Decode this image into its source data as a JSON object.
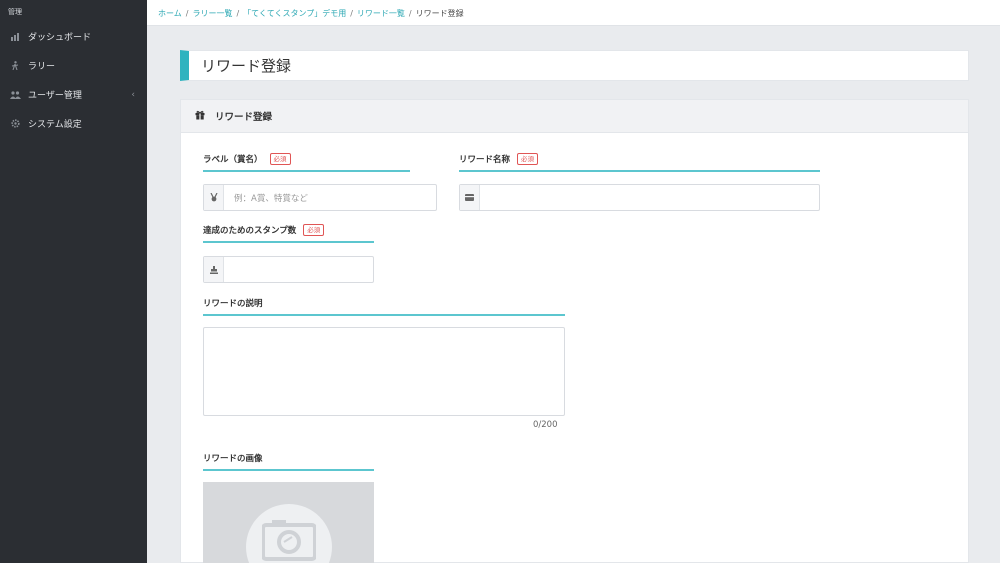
{
  "sidebar": {
    "brand": "管理",
    "items": [
      {
        "label": "ダッシュボード",
        "icon": "chart-icon"
      },
      {
        "label": "ラリー",
        "icon": "walk-icon"
      },
      {
        "label": "ユーザー管理",
        "icon": "users-icon"
      },
      {
        "label": "システム設定",
        "icon": "gear-icon"
      }
    ],
    "chevron": "‹"
  },
  "breadcrumb": {
    "items": [
      "ホーム",
      "ラリー一覧",
      "「てくてくスタンプ」デモ用",
      "リワード一覧"
    ],
    "current": "リワード登録",
    "sep": "/"
  },
  "page": {
    "title": "リワード登録"
  },
  "card": {
    "title": "リワード登録"
  },
  "form": {
    "label_field": {
      "label": "ラベル（賞名）",
      "required": "必須",
      "placeholder": "例：A賞、特賞など"
    },
    "name_field": {
      "label": "リワード名称",
      "required": "必須",
      "placeholder": ""
    },
    "stamps_field": {
      "label": "達成のためのスタンプ数",
      "required": "必須",
      "placeholder": ""
    },
    "description_field": {
      "label": "リワードの説明",
      "counter": "0/200"
    },
    "image_field": {
      "label": "リワードの画像"
    }
  },
  "colors": {
    "accent": "#2fb3bf",
    "sidebar_bg": "#2b2e33",
    "required": "#e05555"
  }
}
